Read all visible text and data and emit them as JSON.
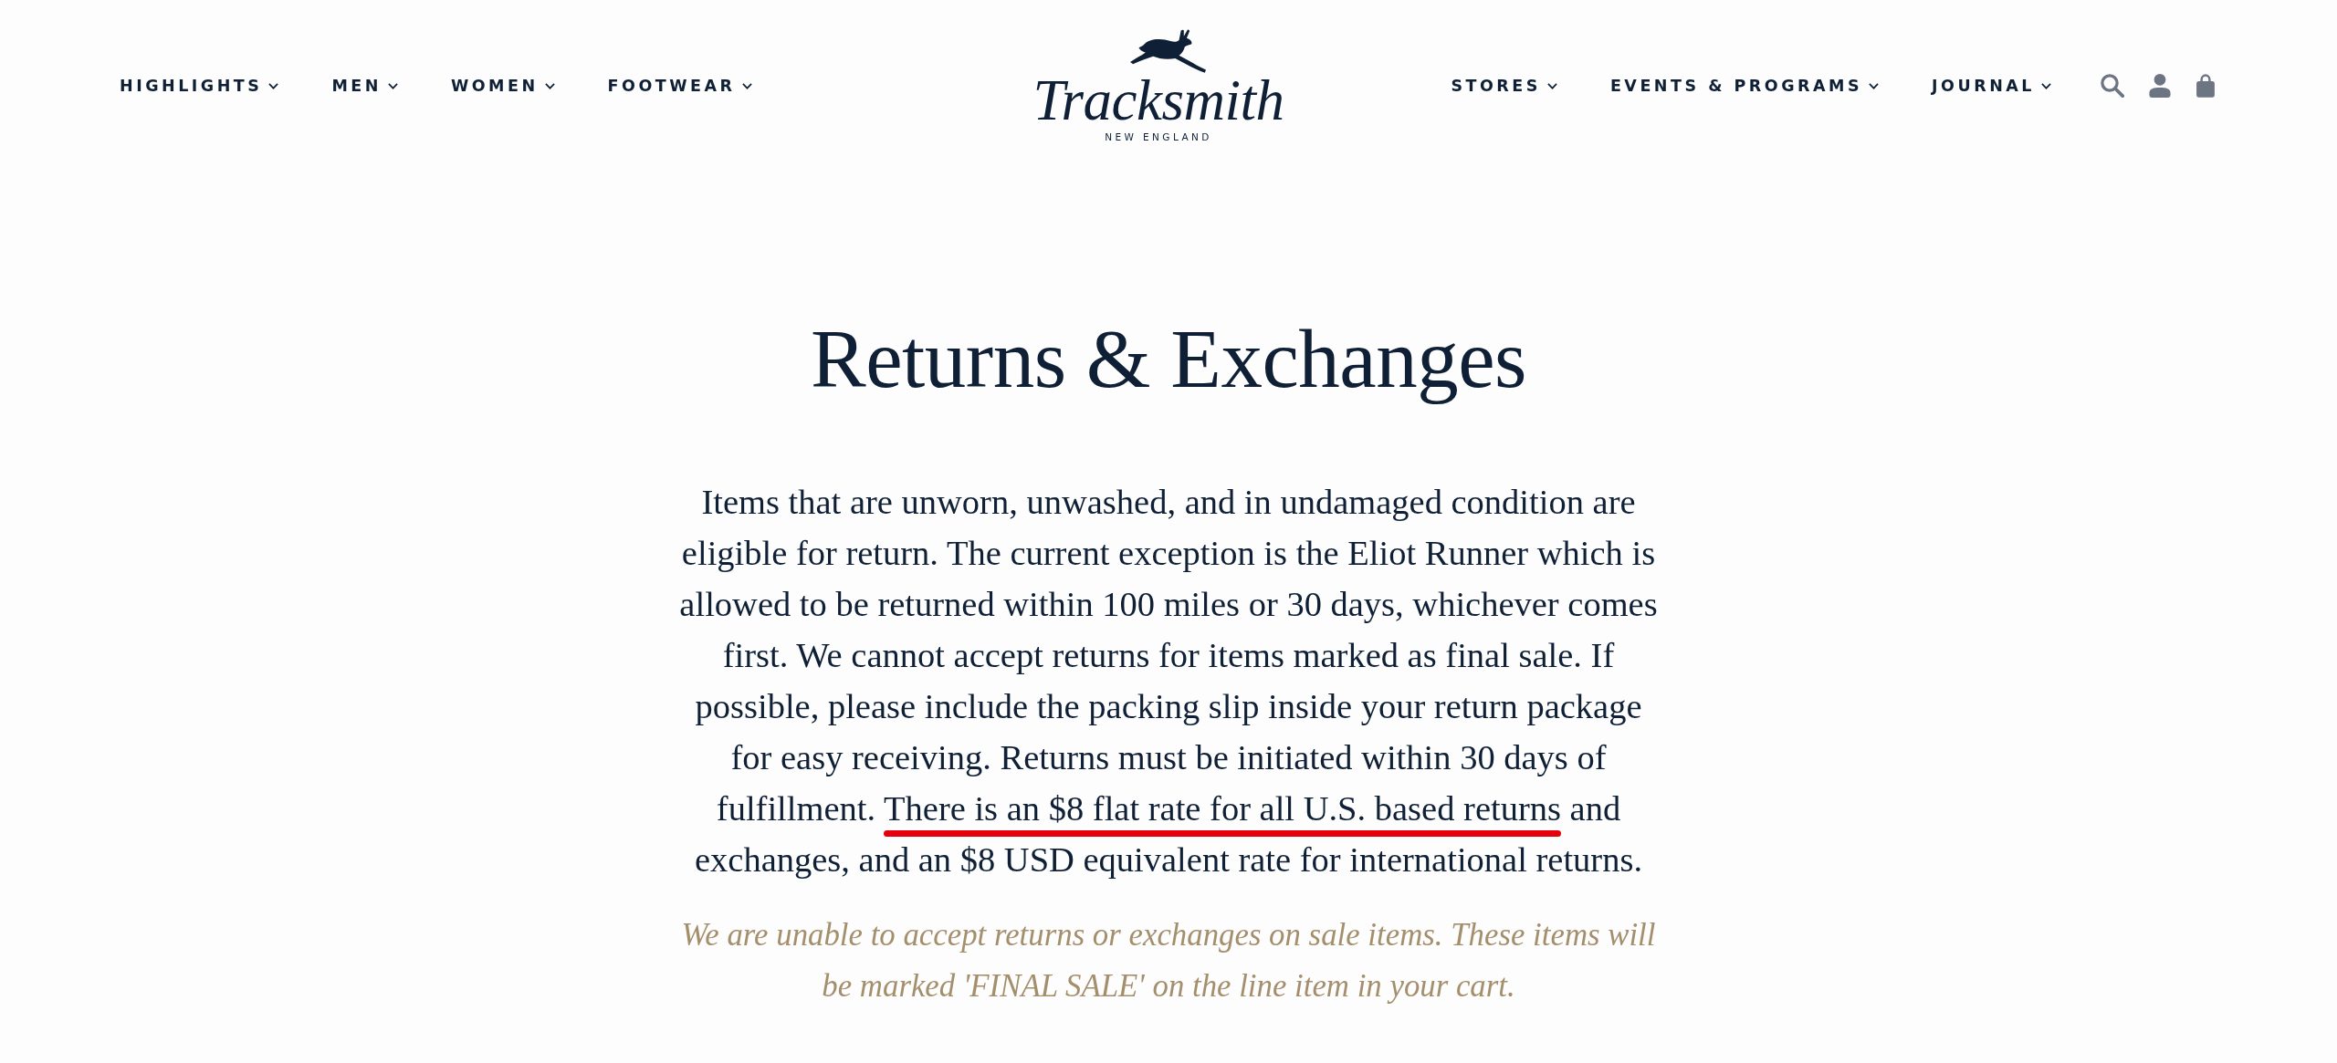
{
  "nav_left": [
    {
      "label": "HIGHLIGHTS",
      "has_menu": true
    },
    {
      "label": "MEN",
      "has_menu": true
    },
    {
      "label": "WOMEN",
      "has_menu": true
    },
    {
      "label": "FOOTWEAR",
      "has_menu": true
    }
  ],
  "logo": {
    "wordmark": "Tracksmith",
    "tagline": "NEW ENGLAND"
  },
  "nav_right": [
    {
      "label": "STORES",
      "has_menu": true
    },
    {
      "label": "EVENTS & PROGRAMS",
      "has_menu": true
    },
    {
      "label": "JOURNAL",
      "has_menu": true
    }
  ],
  "page": {
    "title": "Returns & Exchanges",
    "body_segments": [
      {
        "text": "Items that are unworn, unwashed, and in undamaged condition are eligible for return. The current exception is the Eliot Runner which is allowed to be returned within 100 miles or 30 days, whichever comes first. We cannot accept returns for items marked as final sale. If possible, please include the packing slip inside your return package for easy receiving. Returns must be initiated within 30 days of fulfillment. ",
        "marked": false
      },
      {
        "text": "There is an $8 flat rate for all U.S. based returns",
        "marked": true
      },
      {
        "text": " and exchanges, and an $8 USD equivalent rate for international returns.",
        "marked": false
      }
    ],
    "note": "We are unable to accept returns or exchanges on sale items. These items will be marked 'FINAL SALE' on the line item in your cart."
  }
}
